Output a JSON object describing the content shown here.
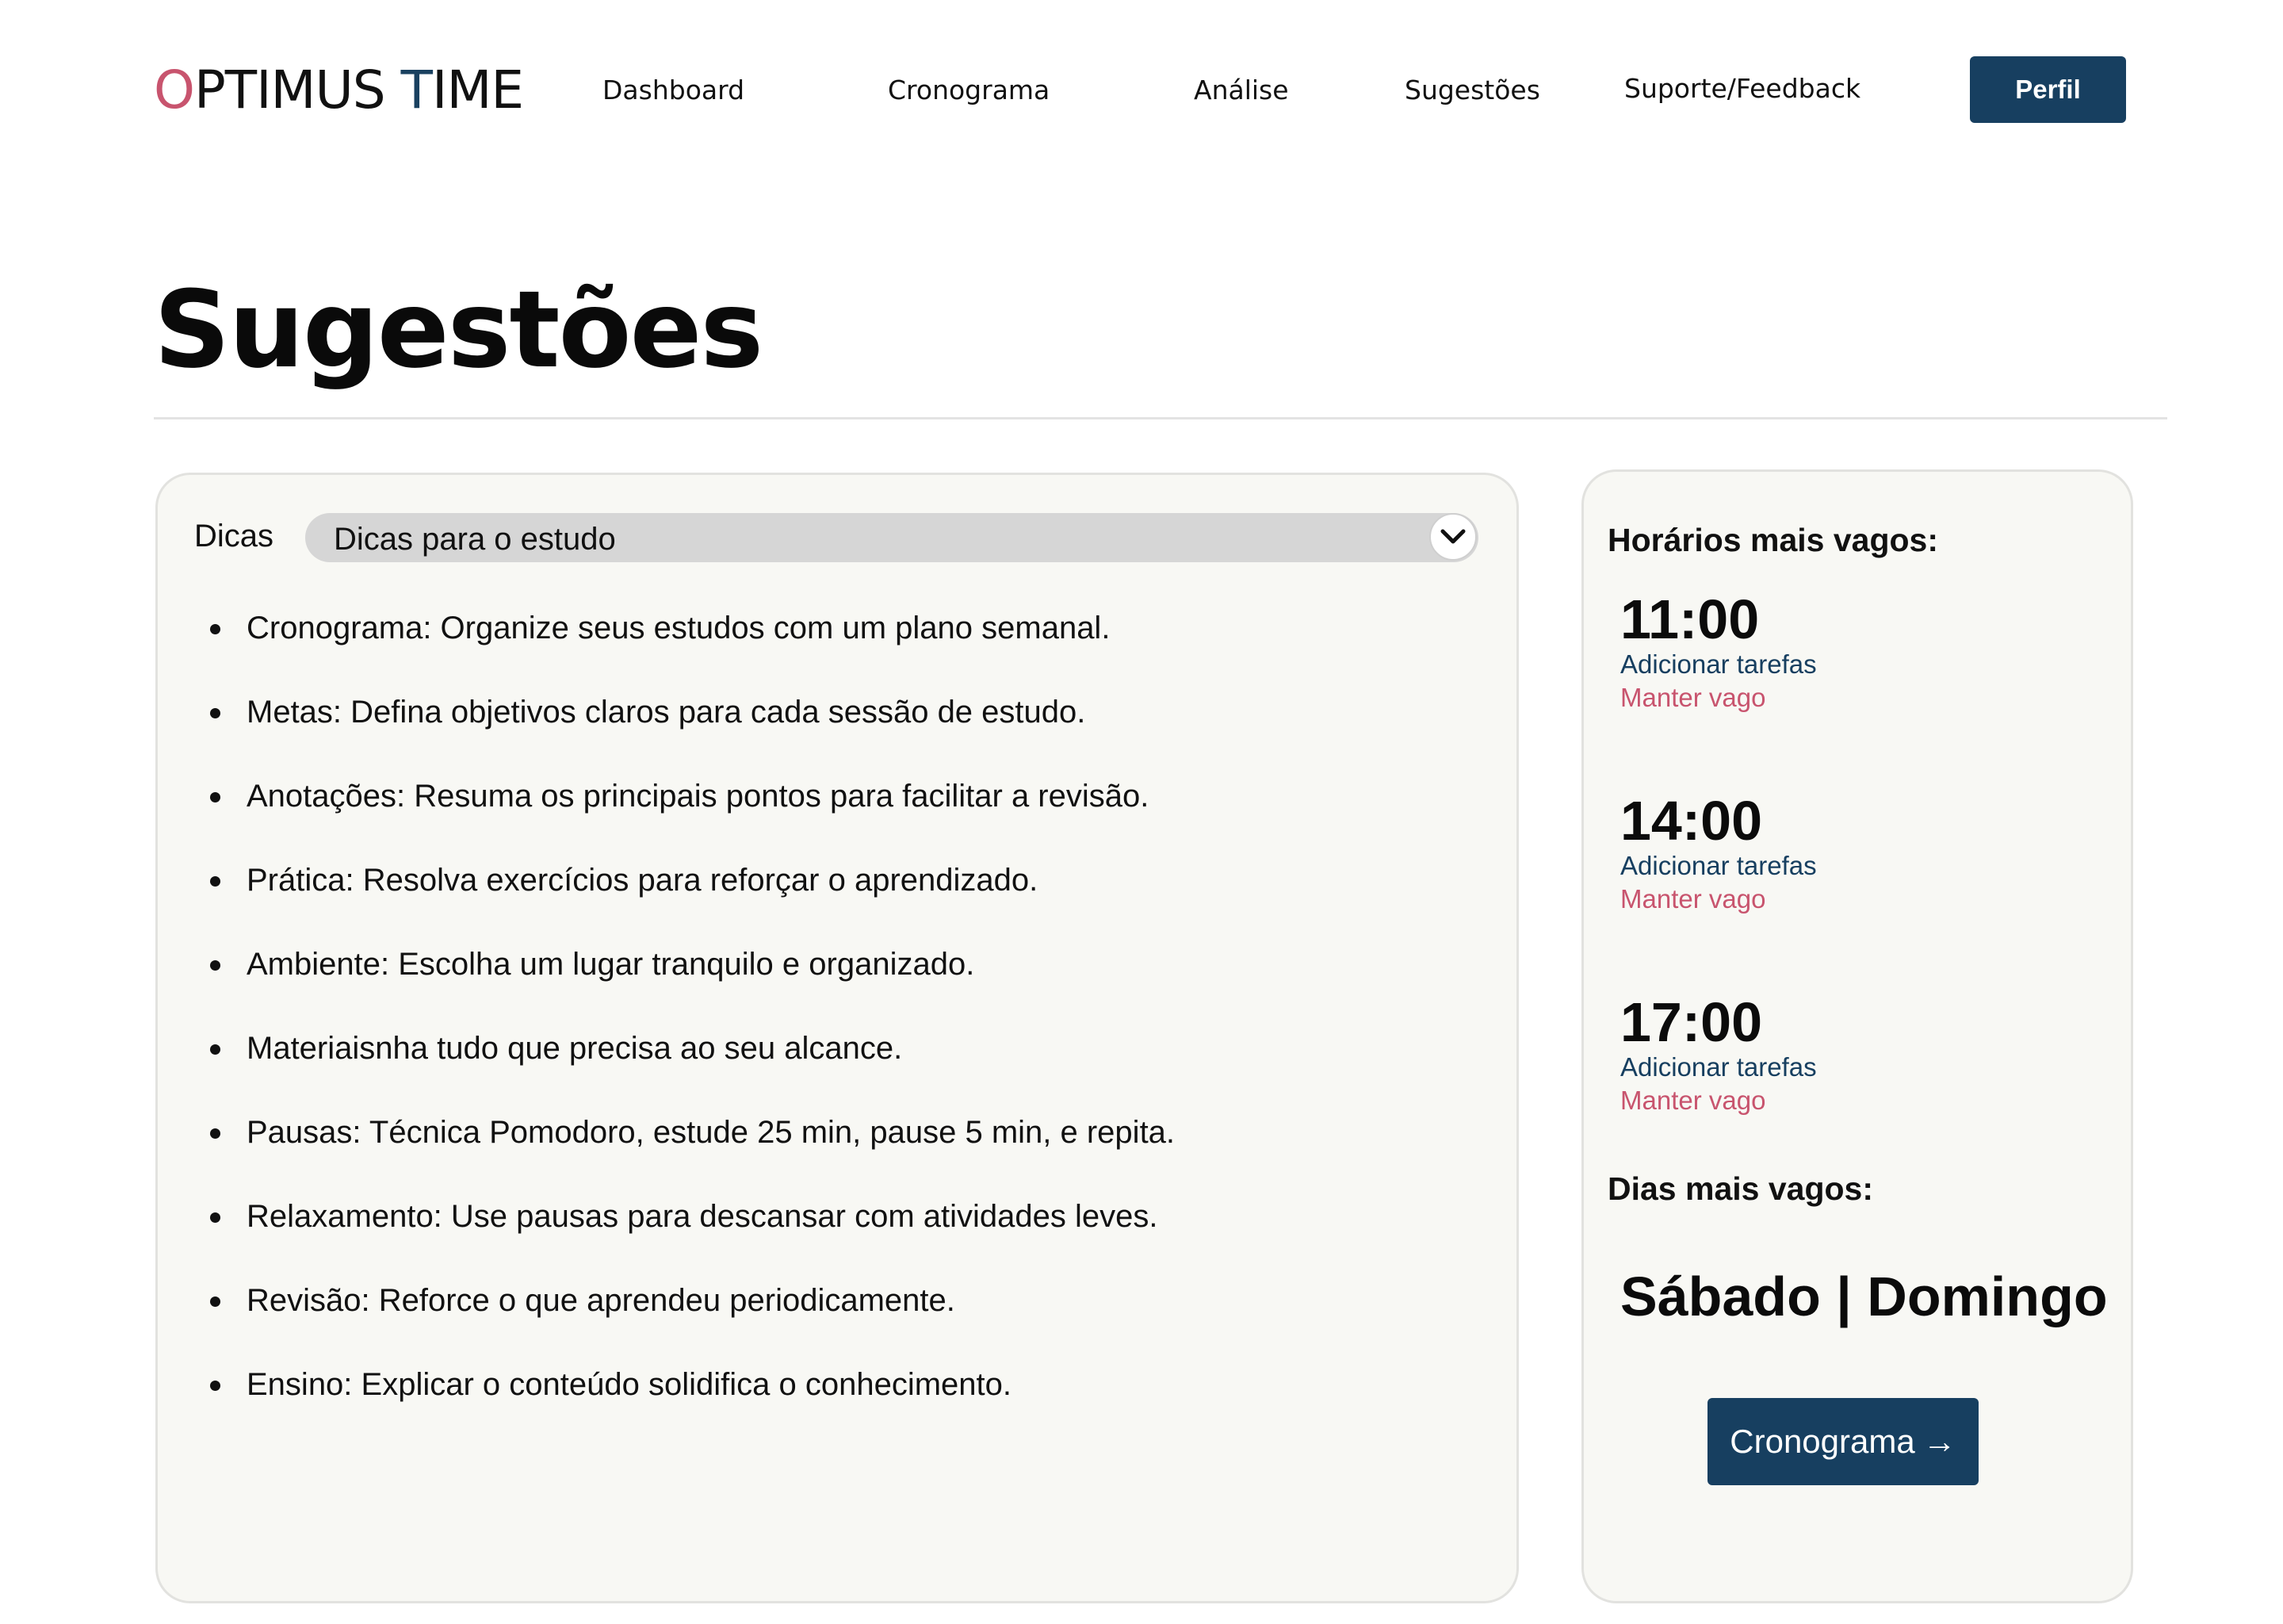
{
  "header": {
    "logo_initial_1": "O",
    "logo_rest_1": "PTIMUS ",
    "logo_initial_2": "T",
    "logo_rest_2": "IME",
    "nav": [
      "Dashboard",
      "Cronograma",
      "Análise",
      "Sugestões",
      "Suporte/Feedback"
    ],
    "profile_label": "Perfil"
  },
  "page": {
    "title": "Sugestões"
  },
  "tips": {
    "label": "Dicas",
    "selected": "Dicas para o estudo",
    "items": [
      "Cronograma: Organize seus estudos com um plano semanal.",
      "Metas: Defina objetivos claros para cada sessão de estudo.",
      "Anotações: Resuma os principais pontos para facilitar a revisão.",
      "Prática: Resolva exercícios para reforçar o aprendizado.",
      "Ambiente: Escolha um lugar tranquilo e organizado.",
      "Materiaisnha tudo que precisa ao seu alcance.",
      "Pausas: Técnica Pomodoro, estude 25 min, pause 5 min, e repita.",
      "Relaxamento: Use pausas para descansar com atividades leves.",
      "Revisão: Reforce o que aprendeu periodicamente.",
      "Ensino: Explicar o conteúdo solidifica o conhecimento."
    ]
  },
  "slots": {
    "heading": "Horários mais vagos:",
    "times": [
      {
        "time": "11:00",
        "add": "Adicionar tarefas",
        "keep": "Manter vago"
      },
      {
        "time": "14:00",
        "add": "Adicionar tarefas",
        "keep": "Manter vago"
      },
      {
        "time": "17:00",
        "add": "Adicionar tarefas",
        "keep": "Manter vago"
      }
    ],
    "days_heading": "Dias mais vagos:",
    "days_value": "Sábado | Domingo",
    "cta_label": "Cronograma",
    "cta_arrow": "→"
  },
  "colors": {
    "accent_navy": "#173f60",
    "accent_rose": "#c8546e",
    "card_bg": "#f8f8f4"
  }
}
